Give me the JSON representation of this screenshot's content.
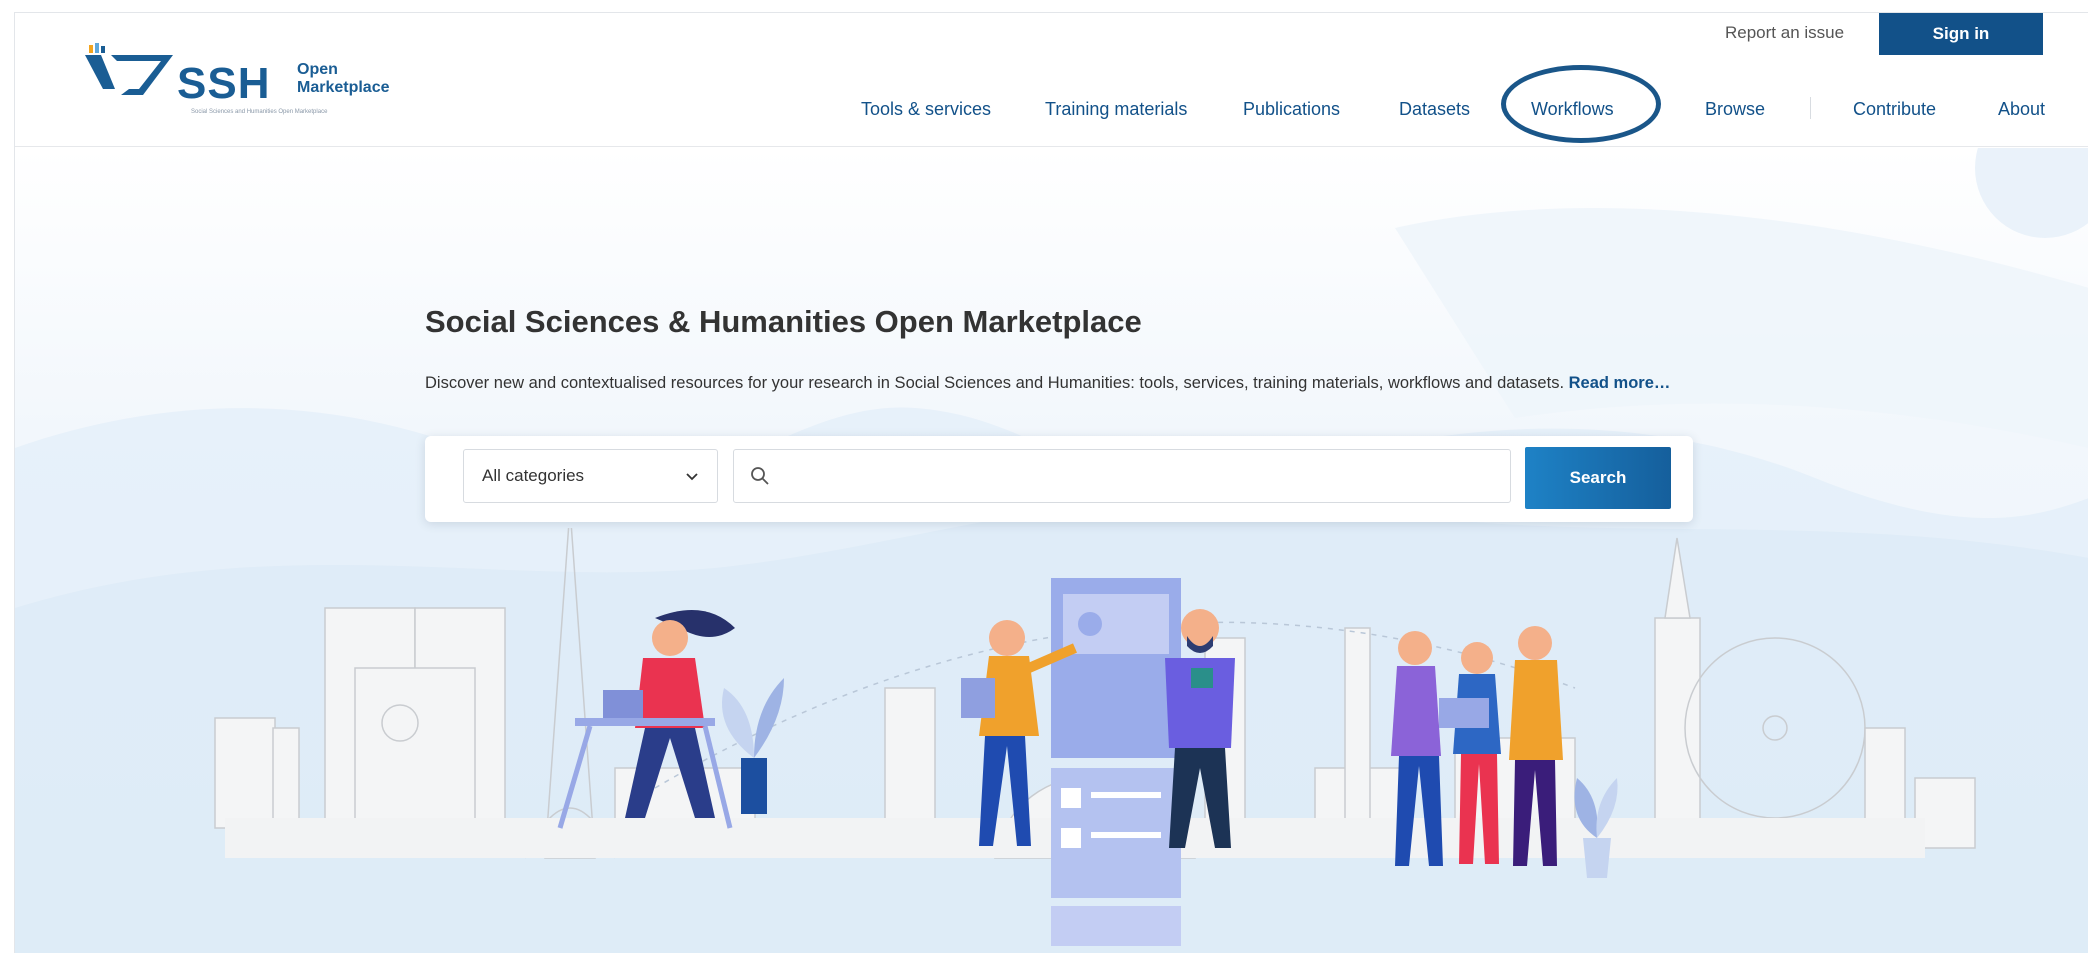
{
  "logo": {
    "brand": "SSH",
    "line1": "Open",
    "line2": "Marketplace",
    "tagline": "Social Sciences and Humanities Open Marketplace"
  },
  "header": {
    "report_issue": "Report an issue",
    "sign_in": "Sign in"
  },
  "nav": {
    "tools": "Tools & services",
    "training": "Training materials",
    "publications": "Publications",
    "datasets": "Datasets",
    "workflows": "Workflows",
    "browse": "Browse",
    "contribute": "Contribute",
    "about": "About"
  },
  "hero": {
    "title": "Social Sciences & Humanities Open Marketplace",
    "description": "Discover new and contextualised resources for your research in Social Sciences and Humanities: tools, services, training materials, workflows and datasets.",
    "read_more": "Read more…"
  },
  "search": {
    "category": "All categories",
    "placeholder": "",
    "button": "Search"
  },
  "colors": {
    "primary": "#125189",
    "accent": "#1e82c6",
    "highlight": "#1a5689"
  },
  "icons": {
    "search": "magnifier",
    "dropdown": "chevron-down"
  }
}
